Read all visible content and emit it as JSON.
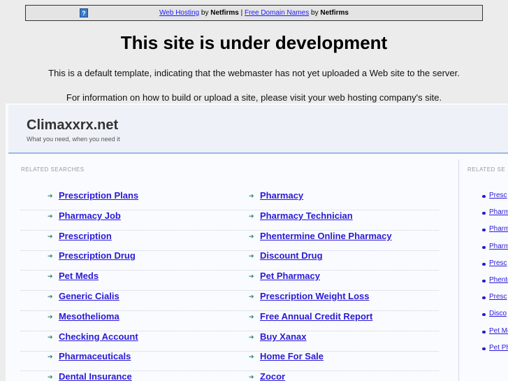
{
  "topbar": {
    "link1": "Web Hosting",
    "by1": " by ",
    "brand1": "Netfirms",
    "sep": " | ",
    "link2": "Free Domain Names",
    "by2": " by ",
    "brand2": "Netfirms",
    "help": "?"
  },
  "heading": "This site is under development",
  "para1": "This is a default template, indicating that the webmaster has not yet uploaded a Web site to the server.",
  "para2": "For information on how to build or upload a site, please visit your web hosting company's site.",
  "site": {
    "title": "Climaxxrx.net",
    "tagline": "What you need, when you need it"
  },
  "related_label": "RELATED SEARCHES",
  "related_label_right": "RELATED SE",
  "left_items": [
    "Prescription Plans",
    "Pharmacy Job",
    "Prescription",
    "Prescription Drug",
    "Pet Meds",
    "Generic Cialis",
    "Mesothelioma",
    "Checking Account",
    "Pharmaceuticals",
    "Dental Insurance"
  ],
  "right_items": [
    "Pharmacy",
    "Pharmacy Technician",
    "Phentermine Online Pharmacy",
    "Discount Drug",
    "Pet Pharmacy",
    "Prescription Weight Loss",
    "Free Annual Credit Report",
    "Buy Xanax",
    "Home For Sale",
    "Zocor"
  ],
  "side_items": [
    "Presc",
    "Pharm",
    "Pharm",
    "Pharm",
    "Presc",
    "Phente",
    "Presc",
    "Disco",
    "Pet Me",
    "Pet Ph"
  ]
}
